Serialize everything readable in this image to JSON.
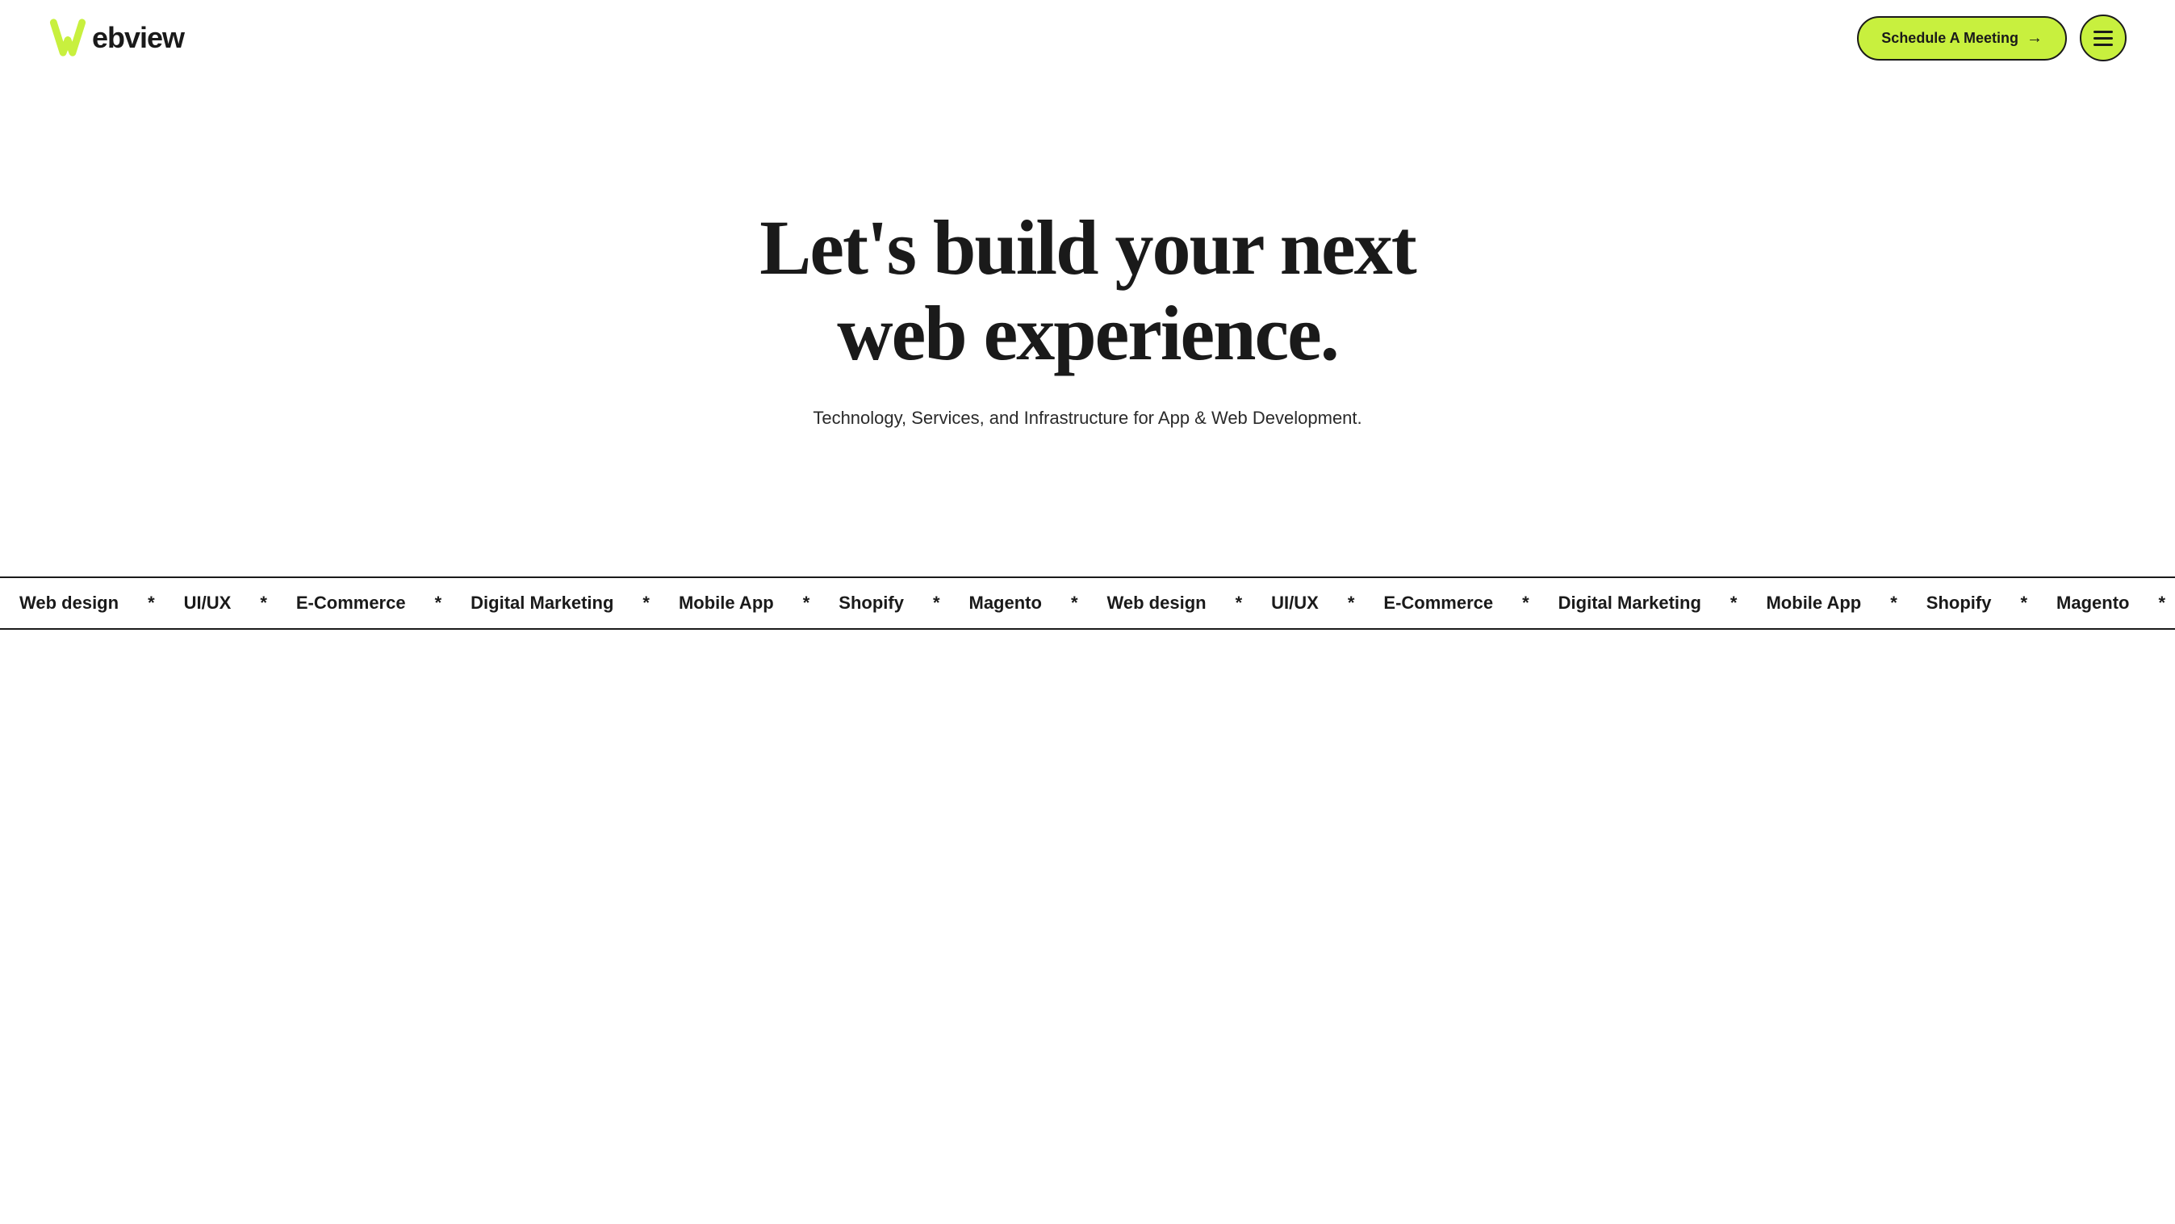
{
  "header": {
    "logo_text": "ebview",
    "schedule_btn_label": "Schedule A Meeting",
    "schedule_btn_arrow": "→"
  },
  "hero": {
    "title_line1": "Let's build your next",
    "title_line2": "web experience.",
    "subtitle": "Technology, Services, and Infrastructure for App & Web Development."
  },
  "ticker": {
    "items": [
      "Web design",
      "UI/UX",
      "E-Commerce",
      "Digital Marketing",
      "Mobile App",
      "Shopify",
      "Magento",
      "Web design",
      "UI/UX",
      "E-Commerce",
      "Digital Marketing",
      "Mobile App",
      "Shopify",
      "Magento"
    ],
    "separator": "*"
  },
  "colors": {
    "accent": "#c8f03e",
    "dark": "#1a1a1a",
    "white": "#ffffff"
  }
}
